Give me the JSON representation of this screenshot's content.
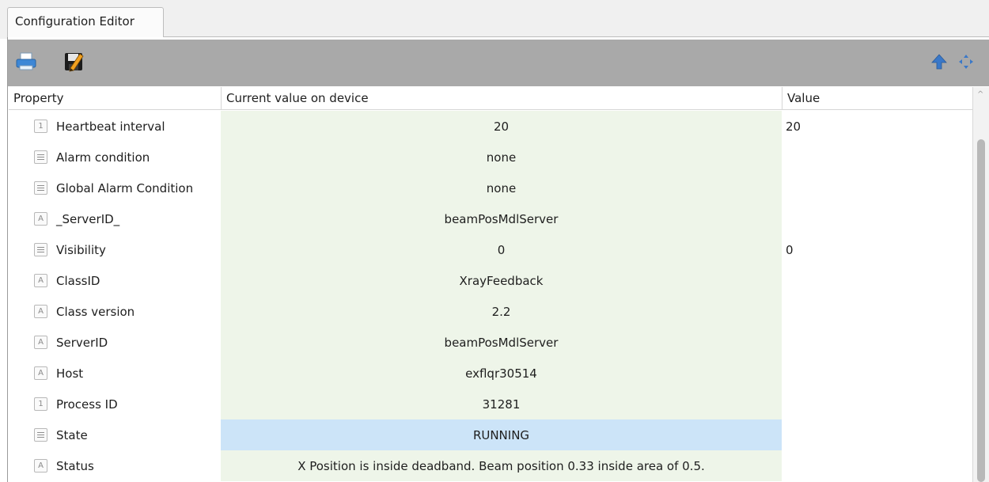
{
  "tab": {
    "label": "Configuration Editor"
  },
  "toolbar": {
    "left_icons": [
      "printer-icon",
      "save-edit-icon"
    ],
    "right_icons": [
      "arrow-up-icon",
      "move-arrows-icon"
    ]
  },
  "columns": {
    "property": "Property",
    "current": "Current value on device",
    "value": "Value"
  },
  "rows": [
    {
      "icon": "number",
      "property": "Heartbeat interval",
      "current": "20",
      "value": "20"
    },
    {
      "icon": "list",
      "property": "Alarm condition",
      "current": "none",
      "value": ""
    },
    {
      "icon": "list",
      "property": "Global Alarm Condition",
      "current": "none",
      "value": ""
    },
    {
      "icon": "text",
      "property": "_ServerID_",
      "current": "beamPosMdlServer",
      "value": ""
    },
    {
      "icon": "list",
      "property": "Visibility",
      "current": "0",
      "value": "0"
    },
    {
      "icon": "text",
      "property": "ClassID",
      "current": "XrayFeedback",
      "value": ""
    },
    {
      "icon": "text",
      "property": "Class version",
      "current": "2.2",
      "value": ""
    },
    {
      "icon": "text",
      "property": "ServerID",
      "current": "beamPosMdlServer",
      "value": ""
    },
    {
      "icon": "text",
      "property": "Host",
      "current": "exflqr30514",
      "value": ""
    },
    {
      "icon": "number",
      "property": "Process ID",
      "current": "31281",
      "value": ""
    },
    {
      "icon": "list",
      "property": "State",
      "current": "RUNNING",
      "value": ""
    },
    {
      "icon": "text",
      "property": "Status",
      "current": "X Position is inside deadband. Beam position 0.33 inside area of 0.5.",
      "value": ""
    }
  ],
  "icon_glyphs": {
    "number": "1",
    "text": "A"
  },
  "colors": {
    "current_bg": "#eef5e9",
    "state_bg": "#cce4f8",
    "toolbar_bg": "#a9a9a9"
  }
}
